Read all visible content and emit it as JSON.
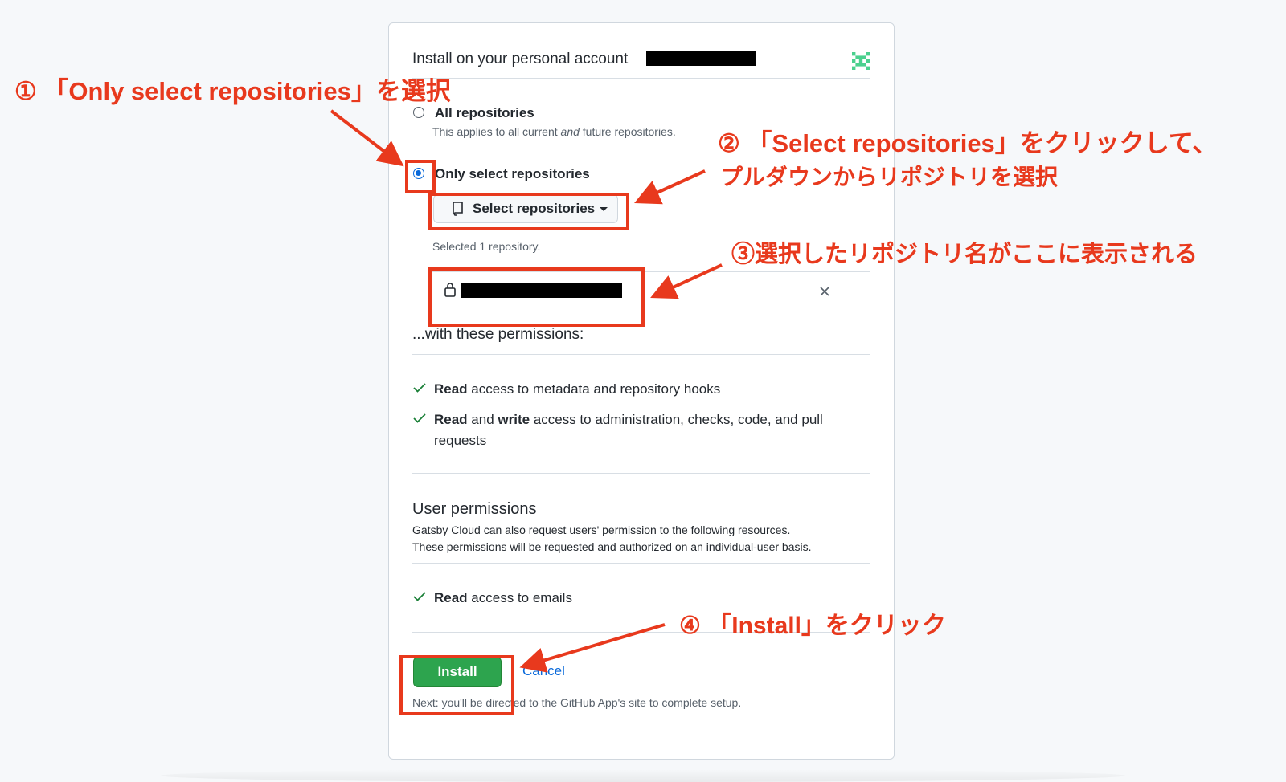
{
  "header": {
    "title": "Install on your personal account"
  },
  "repo_options": {
    "all": {
      "label": "All repositories",
      "desc_prefix": "This applies to all current ",
      "desc_em": "and",
      "desc_suffix": " future repositories."
    },
    "only": {
      "label": "Only select repositories",
      "selected": true
    },
    "select_button": "Select repositories",
    "selected_count": "Selected 1 repository."
  },
  "permissions": {
    "heading": "...with these permissions:",
    "items": [
      {
        "bold1": "Read",
        "text1": " access to metadata and repository hooks"
      },
      {
        "bold1": "Read",
        "mid": " and ",
        "bold2": "write",
        "text2": " access to administration, checks, code, and pull requests"
      }
    ]
  },
  "user_permissions": {
    "title": "User permissions",
    "line1": "Gatsby Cloud can also request users' permission to the following resources.",
    "line2": "These permissions will be requested and authorized on an individual-user basis.",
    "item_bold": "Read",
    "item_text": " access to emails"
  },
  "actions": {
    "install": "Install",
    "cancel": "Cancel",
    "next_note": "Next: you'll be directed to the GitHub App's site to complete setup."
  },
  "icons": {
    "avatar": "identicon-icon",
    "repo": "repo-icon",
    "lock": "lock-icon",
    "remove": "x-icon",
    "check": "check-icon"
  },
  "annotations": {
    "step1": "① 「Only select repositories」を選択",
    "step2_line1": "② 「Select repositories」をクリックして、",
    "step2_line2": "プルダウンからリポジトリを選択",
    "step3": "③選択したリポジトリ名がここに表示される",
    "step4": "④ 「Install」をクリック"
  },
  "colors": {
    "annotation": "#e8391d",
    "primary": "#2da44e",
    "link": "#0969da",
    "check": "#1a7f37"
  }
}
